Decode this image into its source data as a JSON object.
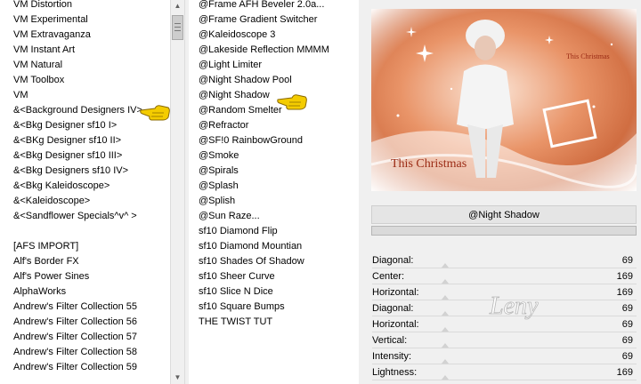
{
  "left_list": {
    "items": [
      "VM Distortion",
      "VM Experimental",
      "VM Extravaganza",
      "VM Instant Art",
      "VM Natural",
      "VM Toolbox",
      "VM",
      "&<Background Designers IV>",
      "&<Bkg Designer sf10 I>",
      "&<BKg Designer sf10 II>",
      "&<Bkg Designer sf10 III>",
      "&<Bkg Designers sf10 IV>",
      "&<Bkg Kaleidoscope>",
      "&<Kaleidoscope>",
      "&<Sandflower Specials^v^ >",
      "",
      "[AFS IMPORT]",
      "Alf's Border FX",
      "Alf's Power Sines",
      "AlphaWorks",
      "Andrew's Filter Collection 55",
      "Andrew's Filter Collection 56",
      "Andrew's Filter Collection 57",
      "Andrew's Filter Collection 58",
      "Andrew's Filter Collection 59"
    ],
    "selected_index": 7
  },
  "middle_list": {
    "items": [
      "@Frame AFH Beveler 2.0a...",
      "@Frame Gradient Switcher",
      "@Kaleidoscope 3",
      "@Lakeside Reflection MMMM",
      "@Light Limiter",
      "@Night Shadow Pool",
      "@Night Shadow",
      "@Random Smelter",
      "@Refractor",
      "@SF!0 RainbowGround",
      "@Smoke",
      "@Spirals",
      "@Splash",
      "@Splish",
      "@Sun Raze...",
      "sf10 Diamond Flip",
      "sf10 Diamond Mountian",
      "sf10 Shades Of Shadow",
      "sf10 Sheer Curve",
      "sf10 Slice N Dice",
      "sf10 Square Bumps",
      "THE TWIST TUT"
    ],
    "selected_index": 6
  },
  "preview": {
    "title_small": "This Christmas",
    "title_large": "This Christmas"
  },
  "filter_name": "@Night Shadow",
  "params": [
    {
      "label": "Diagonal:",
      "value": "69"
    },
    {
      "label": "Center:",
      "value": "169"
    },
    {
      "label": "Horizontal:",
      "value": "169"
    },
    {
      "label": "Diagonal:",
      "value": "69"
    },
    {
      "label": "Horizontal:",
      "value": "69"
    },
    {
      "label": "Vertical:",
      "value": "69"
    },
    {
      "label": "Intensity:",
      "value": "69"
    },
    {
      "label": "Lightness:",
      "value": "169"
    }
  ],
  "watermark_text": "Leny",
  "icons": {
    "pointer_left": "hand-pointer-icon",
    "pointer_mid": "hand-pointer-icon",
    "scroll_up": "arrow-up-icon",
    "scroll_down": "arrow-down-icon"
  },
  "colors": {
    "preview_accent": "#d2683a",
    "pointer_fill": "#f4cc00"
  }
}
